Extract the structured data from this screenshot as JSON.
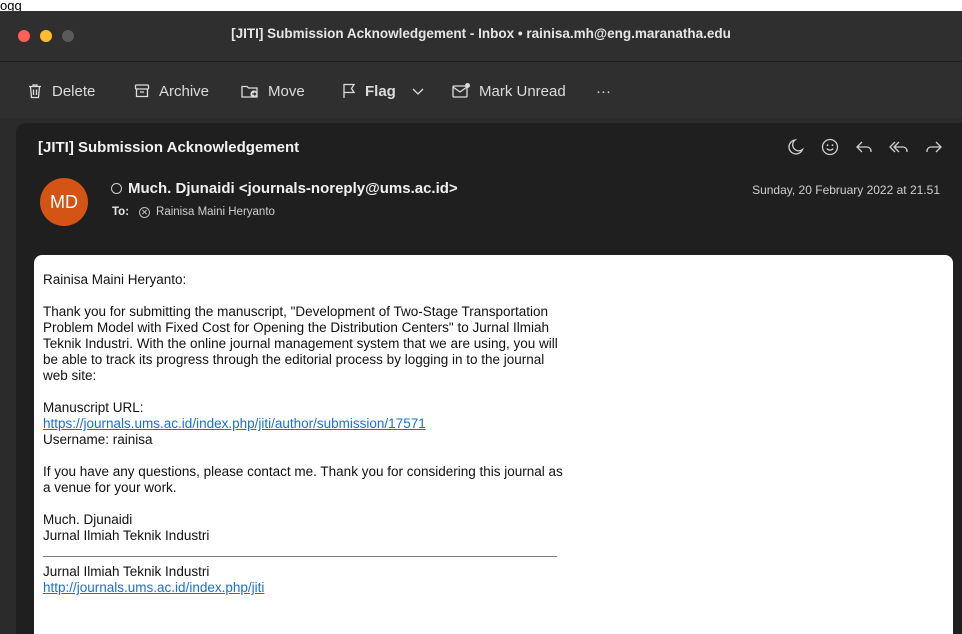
{
  "top_caption": "ogg",
  "window": {
    "title": "[JITI] Submission Acknowledgement - Inbox • rainisa.mh@eng.maranatha.edu"
  },
  "toolbar": {
    "delete": "Delete",
    "archive": "Archive",
    "move": "Move",
    "flag": "Flag",
    "mark_unread": "Mark Unread",
    "more": "···"
  },
  "message": {
    "subject": "[JITI] Submission Acknowledgement",
    "avatar_initials": "MD",
    "avatar_color": "#d35414",
    "sender": "Much. Djunaidi <journals-noreply@ums.ac.id>",
    "to_label": "To:",
    "to_name": "Rainisa Maini Heryanto",
    "date": "Sunday, 20 February 2022 at 21.51"
  },
  "body": {
    "greeting": "Rainisa Maini Heryanto:",
    "paragraph1": "Thank you for submitting the manuscript, \"Development of Two-Stage Transportation Problem Model with Fixed Cost for Opening the Distribution Centers\" to Jurnal Ilmiah Teknik Industri. With the online journal management system that we are using, you will be able to track its progress through the editorial process by logging in to the journal web site:",
    "manuscript_label": "Manuscript URL:",
    "manuscript_url": "https://journals.ums.ac.id/index.php/jiti/author/submission/17571",
    "username": "Username: rainisa",
    "paragraph2": "If you have any questions, please contact me. Thank you for considering this journal as a venue for your work.",
    "sign_name": "Much. Djunaidi",
    "sign_journal": "Jurnal Ilmiah Teknik Industri",
    "footer_journal": "Jurnal Ilmiah Teknik Industri",
    "footer_url": "http://journals.ums.ac.id/index.php/jiti"
  }
}
